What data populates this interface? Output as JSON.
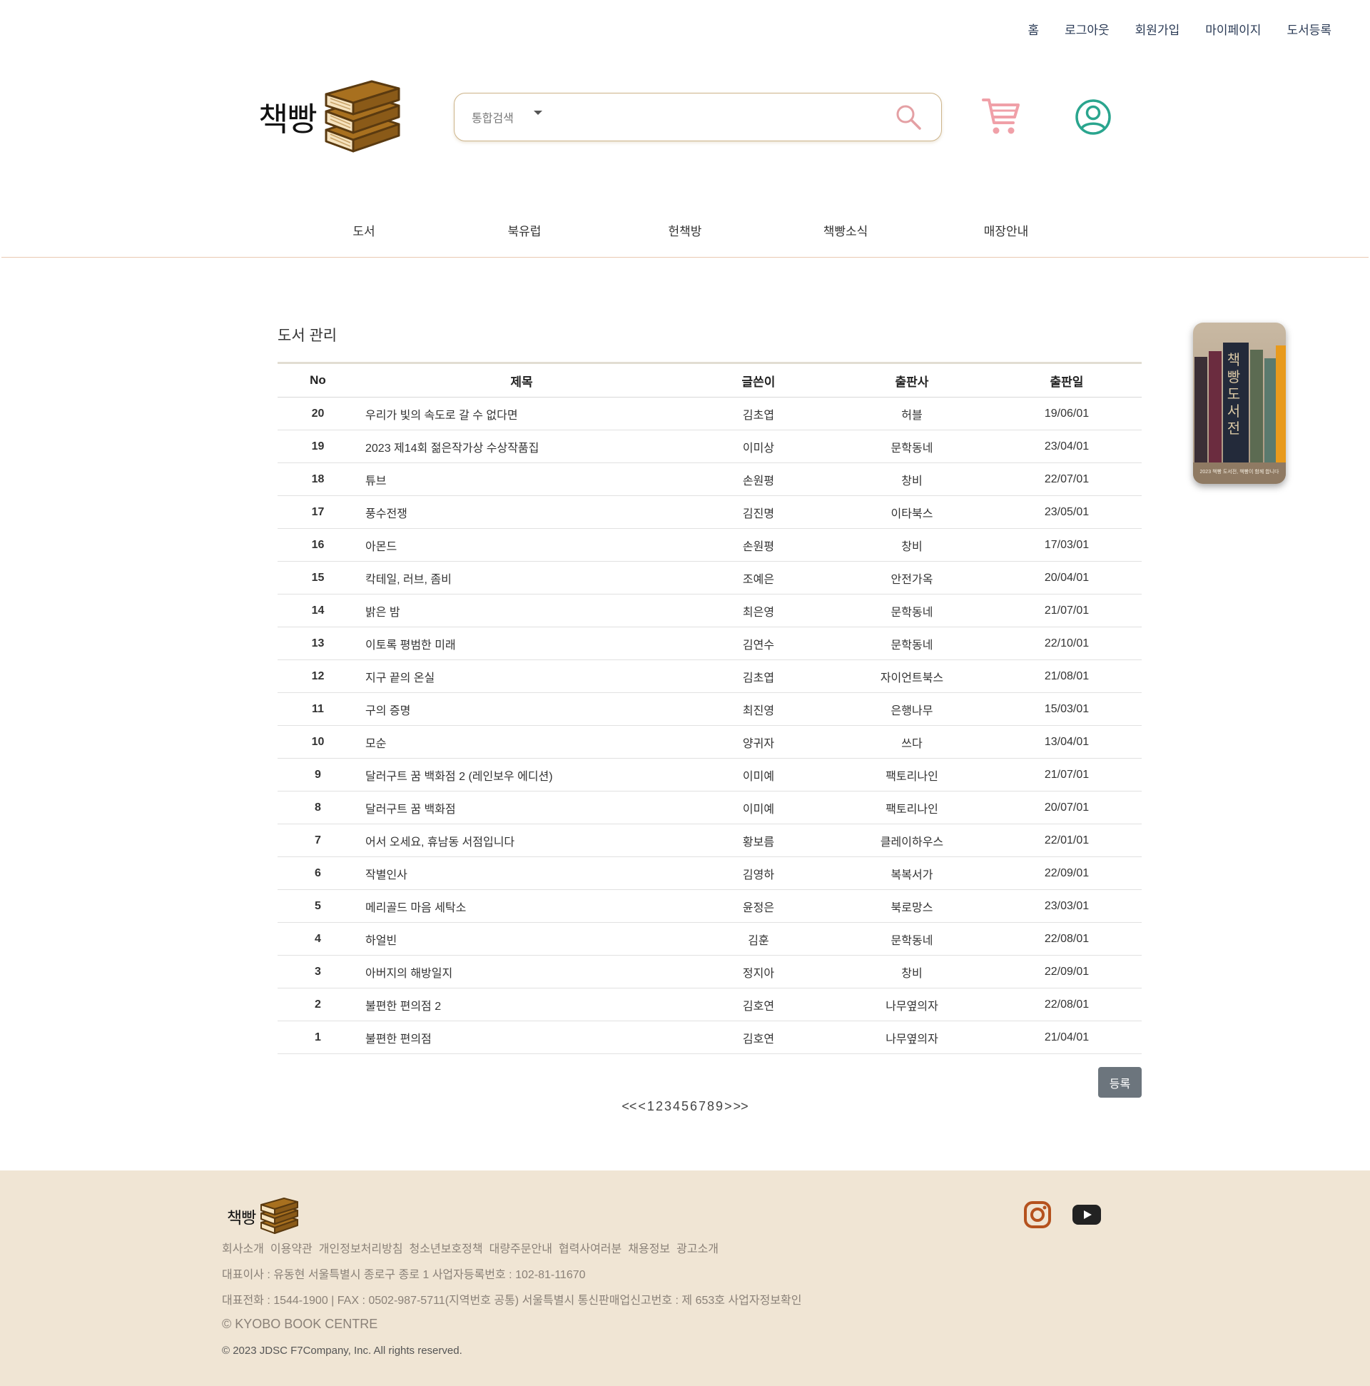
{
  "top_links": [
    "홈",
    "로그아웃",
    "회원가입",
    "마이페이지",
    "도서등록"
  ],
  "logo": {
    "text": "책빵"
  },
  "search": {
    "category": "통합검색",
    "value": "",
    "placeholder": ""
  },
  "icons": {
    "cart": "cart-icon",
    "user": "user-circle-icon",
    "search": "search-icon",
    "instagram": "instagram-icon",
    "youtube": "youtube-icon"
  },
  "colors": {
    "accent_border": "#cdb48a",
    "cart": "#f0a0a8",
    "user": "#2aa58e",
    "button": "#6c757d",
    "footer_bg": "#f0e5d4",
    "instagram": "#b5521e"
  },
  "nav": [
    "도서",
    "북유럽",
    "헌책방",
    "책빵소식",
    "매장안내"
  ],
  "page_title": "도서 관리",
  "table": {
    "headers": {
      "no": "No",
      "title": "제목",
      "author": "글쓴이",
      "publisher": "출판사",
      "date": "출판일"
    },
    "rows": [
      {
        "no": "20",
        "title": "우리가 빛의 속도로 갈 수 없다면",
        "author": "김초엽",
        "publisher": "허블",
        "date": "19/06/01"
      },
      {
        "no": "19",
        "title": "2023 제14회 젊은작가상 수상작품집",
        "author": "이미상",
        "publisher": "문학동네",
        "date": "23/04/01"
      },
      {
        "no": "18",
        "title": "튜브",
        "author": "손원평",
        "publisher": "창비",
        "date": "22/07/01"
      },
      {
        "no": "17",
        "title": "풍수전쟁",
        "author": "김진명",
        "publisher": "이타북스",
        "date": "23/05/01"
      },
      {
        "no": "16",
        "title": "아몬드",
        "author": "손원평",
        "publisher": "창비",
        "date": "17/03/01"
      },
      {
        "no": "15",
        "title": "칵테일, 러브, 좀비",
        "author": "조예은",
        "publisher": "안전가옥",
        "date": "20/04/01"
      },
      {
        "no": "14",
        "title": "밝은 밤",
        "author": "최은영",
        "publisher": "문학동네",
        "date": "21/07/01"
      },
      {
        "no": "13",
        "title": "이토록 평범한 미래",
        "author": "김연수",
        "publisher": "문학동네",
        "date": "22/10/01"
      },
      {
        "no": "12",
        "title": "지구 끝의 온실",
        "author": "김초엽",
        "publisher": "자이언트북스",
        "date": "21/08/01"
      },
      {
        "no": "11",
        "title": "구의 증명",
        "author": "최진영",
        "publisher": "은행나무",
        "date": "15/03/01"
      },
      {
        "no": "10",
        "title": "모순",
        "author": "양귀자",
        "publisher": "쓰다",
        "date": "13/04/01"
      },
      {
        "no": "9",
        "title": "달러구트 꿈 백화점 2 (레인보우 에디션)",
        "author": "이미예",
        "publisher": "팩토리나인",
        "date": "21/07/01"
      },
      {
        "no": "8",
        "title": "달러구트 꿈 백화점",
        "author": "이미예",
        "publisher": "팩토리나인",
        "date": "20/07/01"
      },
      {
        "no": "7",
        "title": "어서 오세요, 휴남동 서점입니다",
        "author": "황보름",
        "publisher": "클레이하우스",
        "date": "22/01/01"
      },
      {
        "no": "6",
        "title": "작별인사",
        "author": "김영하",
        "publisher": "복복서가",
        "date": "22/09/01"
      },
      {
        "no": "5",
        "title": "메리골드 마음 세탁소",
        "author": "윤정은",
        "publisher": "북로망스",
        "date": "23/03/01"
      },
      {
        "no": "4",
        "title": "하얼빈",
        "author": "김훈",
        "publisher": "문학동네",
        "date": "22/08/01"
      },
      {
        "no": "3",
        "title": "아버지의 해방일지",
        "author": "정지아",
        "publisher": "창비",
        "date": "22/09/01"
      },
      {
        "no": "2",
        "title": "불편한 편의점 2",
        "author": "김호연",
        "publisher": "나무옆의자",
        "date": "22/08/01"
      },
      {
        "no": "1",
        "title": "불편한 편의점",
        "author": "김호연",
        "publisher": "나무옆의자",
        "date": "21/04/01"
      }
    ]
  },
  "register_button": "등록",
  "pagination": {
    "first": "<<",
    "prev": "<",
    "pages": [
      "1",
      "2",
      "3",
      "4",
      "5",
      "6",
      "7",
      "8",
      "9"
    ],
    "next": ">",
    "last": ">>"
  },
  "side_banner": {
    "title": "책빵도서전",
    "caption": "2023 책빵 도서전, 책빵이 함께 합니다"
  },
  "footer": {
    "logo_text": "책빵",
    "links": [
      "회사소개",
      "이용약관",
      "개인정보처리방침",
      "청소년보호정책",
      "대량주문안내",
      "협력사여러분",
      "채용정보",
      "광고소개"
    ],
    "line1": "대표이사 : 유동현 서울특별시 종로구 종로 1 사업자등록번호 : 102-81-11670",
    "line2": "대표전화 : 1544-1900 | FAX : 0502-987-5711(지역번호 공통) 서울특별시 통신판매업신고번호 : 제 653호 사업자정보확인",
    "kyobo": "© KYOBO BOOK CENTRE",
    "copyright": "© 2023 JDSC F7Company, Inc. All rights reserved."
  }
}
